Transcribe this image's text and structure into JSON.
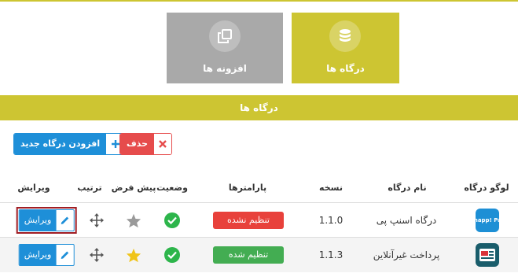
{
  "tiles": {
    "gateways_label": "درگاه ها",
    "addons_label": "افزونه ها"
  },
  "section_title": "درگاه ها",
  "toolbar": {
    "add_label": "افزودن درگاه جدید",
    "delete_label": "حذف"
  },
  "table": {
    "headers": {
      "logo": "لوگو درگاه",
      "name": "نام درگاه",
      "version": "نسخه",
      "params": "پارامترها",
      "status": "وضعیت",
      "default": "پیش فرض",
      "order": "ترتیب",
      "edit": "ویرایش"
    },
    "rows": [
      {
        "logo_text": "Snapp! Pay",
        "name": "درگاه اسنپ پی",
        "version": "1.1.0",
        "params": "تنظیم نشده",
        "params_color": "#e8413b",
        "status": "active",
        "default": false,
        "edit": "ویرایش"
      },
      {
        "logo_text": "",
        "name": "پرداخت غیرآنلاین",
        "version": "1.1.3",
        "params": "تنظیم شده",
        "params_color": "#43ad52",
        "status": "active",
        "default": true,
        "edit": "ویرایش"
      }
    ]
  },
  "colors": {
    "accent": "#cdc532",
    "tile_inactive": "#a9a9a9",
    "primary": "#1e8fd8",
    "danger": "#e64c4c",
    "success": "#2db54b",
    "star_default": "#f0c419",
    "star_off": "#9a9a9a",
    "focus_outline": "#a01d24"
  },
  "icons": {
    "gateways_tile": "database-icon",
    "addons_tile": "copy-icon",
    "add": "plus-icon",
    "delete": "close-icon",
    "edit": "pencil-icon",
    "order": "move-arrows-icon",
    "status": "check-circle-icon",
    "default": "star-icon"
  }
}
